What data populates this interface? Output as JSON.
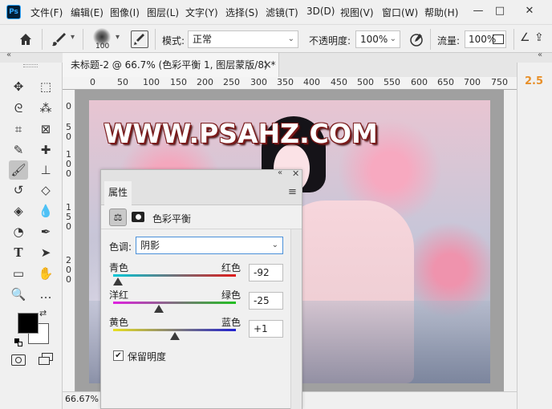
{
  "app": {
    "logo": "Ps"
  },
  "menu": [
    "文件(F)",
    "编辑(E)",
    "图像(I)",
    "图层(L)",
    "文字(Y)",
    "选择(S)",
    "滤镜(T)",
    "3D(D)",
    "视图(V)",
    "窗口(W)",
    "帮助(H)"
  ],
  "window_controls": {
    "minimize": "—",
    "maximize": "□",
    "close": "✕"
  },
  "options": {
    "brush_size": "100",
    "mode_label": "模式:",
    "mode_value": "正常",
    "opacity_label": "不透明度:",
    "opacity_value": "100%",
    "flow_label": "流量:",
    "flow_value": "100%"
  },
  "document": {
    "tab_title": "未标题-2 @ 66.7% (色彩平衡 1, 图层蒙版/8) *",
    "close": "×",
    "zoom": "66.67%"
  },
  "ruler_h": [
    "0",
    "50",
    "100",
    "150",
    "200",
    "250",
    "300",
    "350",
    "400",
    "450",
    "500",
    "550",
    "600",
    "650",
    "700",
    "750"
  ],
  "ruler_v": [
    "0",
    "5",
    "0",
    "1",
    "0",
    "0",
    "1",
    "5",
    "0",
    "2",
    "0",
    "0"
  ],
  "watermark": "WWW.PSAHZ.COM",
  "right_dock": {
    "value": "2.5"
  },
  "properties": {
    "tab_label": "属性",
    "adjustment_name": "色彩平衡",
    "tone_label": "色调:",
    "tone_value": "阴影",
    "sliders": [
      {
        "left": "青色",
        "right": "红色",
        "value": "-92",
        "level": -92,
        "colors": [
          "#00c8d8",
          "#e01a1a"
        ]
      },
      {
        "left": "洋红",
        "right": "绿色",
        "value": "-25",
        "level": -25,
        "colors": [
          "#e020e0",
          "#20c020"
        ]
      },
      {
        "left": "黄色",
        "right": "蓝色",
        "value": "+1",
        "level": 1,
        "colors": [
          "#e8e020",
          "#2020d0"
        ]
      }
    ],
    "preserve_label": "保留明度",
    "preserve_checked": "✔"
  }
}
